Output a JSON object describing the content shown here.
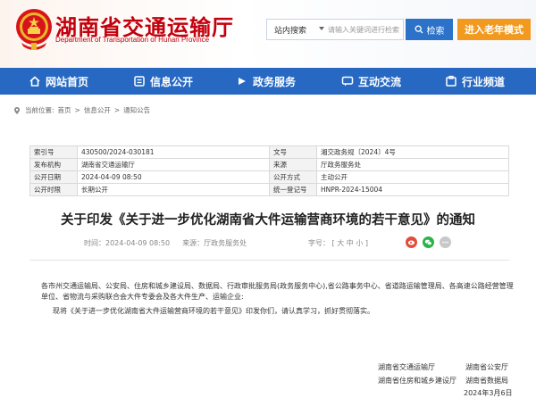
{
  "header": {
    "title": "湖南省交通运输厅",
    "subtitle": "Department of Transportation of Hunan Province",
    "emblem_icon": "national-emblem-icon"
  },
  "search": {
    "scope": "站内搜索",
    "placeholder": "请输入关键词进行检索",
    "button_label": "检索",
    "elder_mode_label": "进入老年模式"
  },
  "nav": {
    "items": [
      {
        "label": "网站首页",
        "icon": "home-icon"
      },
      {
        "label": "信息公开",
        "icon": "info-icon"
      },
      {
        "label": "政务服务",
        "icon": "service-icon"
      },
      {
        "label": "互动交流",
        "icon": "chat-icon"
      },
      {
        "label": "行业频道",
        "icon": "channel-icon"
      }
    ]
  },
  "breadcrumb": {
    "prefix": "当前位置:",
    "items": [
      "首页",
      "信息公开",
      "通知公告"
    ],
    "separator": ">"
  },
  "info": {
    "index_label": "索引号",
    "index_value": "430500/2024-030181",
    "doc_no_label": "文号",
    "doc_no_value": "湘交政务规〔2024〕4号",
    "publisher_label": "发布机构",
    "publisher_value": "湖南省交通运输厅",
    "source_label": "来源",
    "source_value": "厅政务服务处",
    "date_label": "公开日期",
    "date_value": "2024-04-09 08:50",
    "method_label": "公开方式",
    "method_value": "主动公开",
    "period_label": "公开时限",
    "period_value": "长期公开",
    "code_label": "统一登记号",
    "code_value": "HNPR-2024-15004"
  },
  "article": {
    "title": "关于印发《关于进一步优化湖南省大件运输营商环境的若干意见》的通知",
    "time_label": "时间：",
    "time_value": "2024-04-09 08:50",
    "source_label": "来源：",
    "source_value": "厅政务服务处",
    "font_size_label": "字号：",
    "font_large": "大",
    "font_medium": "中",
    "font_small": "小",
    "paragraph1": "各市州交通运输局、公安局、住房和城乡建设局、数据局、行政审批服务局(政务服务中心),省公路事务中心、省道路运输管理局、各高速公路经营管理单位、省物流与采购联合会大件专委会及各大件生产、运输企业:",
    "paragraph2": "现将《关于进一步优化湖南省大件运输营商环境的若干意见》印发你们，请认真学习，抓好贯彻落实。"
  },
  "signatures": {
    "sig1": "湖南省交通运输厅",
    "sig2": "湖南省公安厅",
    "sig3": "湖南省住房和城乡建设厅",
    "sig4": "湖南省数据局",
    "date": "2024年3月6日"
  },
  "colors": {
    "brand_red": "#c3000d",
    "nav_blue": "#2668c2",
    "search_blue": "#2c72c8",
    "elder_orange": "#f29a1f"
  }
}
